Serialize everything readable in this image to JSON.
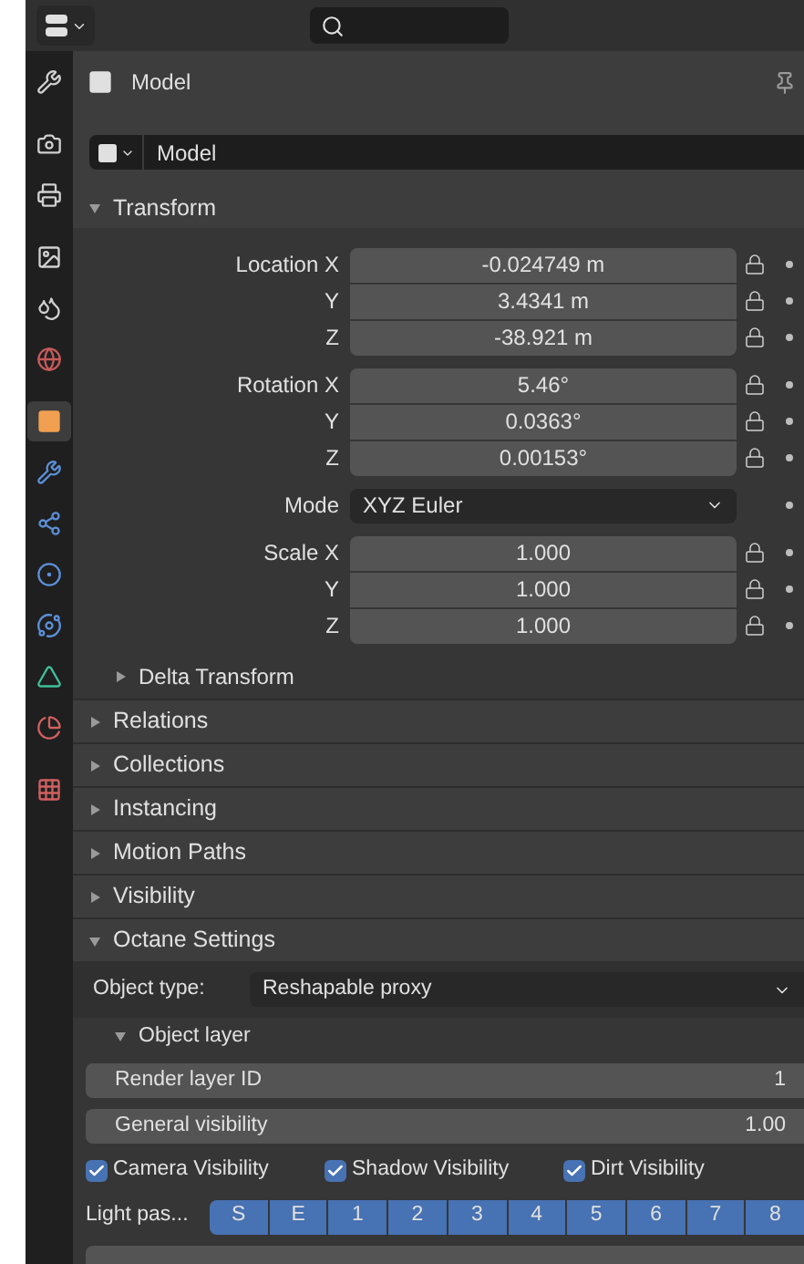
{
  "sidebar": {
    "tabs": [
      {
        "kind": "tool",
        "selected": false
      },
      {
        "kind": "render",
        "selected": false
      },
      {
        "kind": "output",
        "selected": false
      },
      {
        "kind": "view_layer",
        "selected": false
      },
      {
        "kind": "scene",
        "selected": false
      },
      {
        "kind": "world",
        "selected": false
      },
      {
        "kind": "object",
        "selected": true
      },
      {
        "kind": "modifier",
        "selected": false
      },
      {
        "kind": "particles",
        "selected": false
      },
      {
        "kind": "physics",
        "selected": false
      },
      {
        "kind": "constraints",
        "selected": false
      },
      {
        "kind": "data",
        "selected": false
      },
      {
        "kind": "material",
        "selected": false
      },
      {
        "kind": "texture",
        "selected": false
      }
    ]
  },
  "context": {
    "title": "Model"
  },
  "datablock": {
    "value": "Model"
  },
  "transform": {
    "title": "Transform",
    "expanded": true,
    "groups": [
      {
        "kind": "vector",
        "rows": [
          {
            "label": "Location X",
            "value": "-0.024749 m"
          },
          {
            "label": "Y",
            "value": "3.4341 m"
          },
          {
            "label": "Z",
            "value": "-38.921 m"
          }
        ]
      },
      {
        "kind": "vector",
        "rows": [
          {
            "label": "Rotation X",
            "value": "5.46°"
          },
          {
            "label": "Y",
            "value": "0.0363°"
          },
          {
            "label": "Z",
            "value": "0.00153°"
          }
        ]
      },
      {
        "kind": "enum",
        "label": "Mode",
        "value": "XYZ Euler"
      },
      {
        "kind": "vector",
        "rows": [
          {
            "label": "Scale X",
            "value": "1.000"
          },
          {
            "label": "Y",
            "value": "1.000"
          },
          {
            "label": "Z",
            "value": "1.000"
          }
        ]
      }
    ],
    "delta": {
      "title": "Delta Transform",
      "expanded": false
    }
  },
  "panels": [
    {
      "title": "Relations",
      "expanded": false
    },
    {
      "title": "Collections",
      "expanded": false
    },
    {
      "title": "Instancing",
      "expanded": false
    },
    {
      "title": "Motion Paths",
      "expanded": false
    },
    {
      "title": "Visibility",
      "expanded": false
    },
    {
      "title": "Octane Settings",
      "expanded": true
    }
  ],
  "octane": {
    "object_type": {
      "label": "Object type:",
      "value": "Reshapable proxy"
    },
    "object_layer": {
      "title": "Object layer",
      "expanded": true
    },
    "fields": [
      {
        "label": "Render layer ID",
        "value": "1"
      },
      {
        "label": "General visibility",
        "value": "1.00"
      }
    ],
    "checkboxes": [
      {
        "label": "Camera Visibility",
        "checked": true
      },
      {
        "label": "Shadow Visibility",
        "checked": true
      },
      {
        "label": "Dirt Visibility",
        "checked": true
      }
    ],
    "light_pass": {
      "label": "Light pas...",
      "buttons": [
        {
          "label": "S",
          "selected": true
        },
        {
          "label": "E",
          "selected": true
        },
        {
          "label": "1",
          "selected": true
        },
        {
          "label": "2",
          "selected": true
        },
        {
          "label": "3",
          "selected": true
        },
        {
          "label": "4",
          "selected": true
        },
        {
          "label": "5",
          "selected": true
        },
        {
          "label": "6",
          "selected": true
        },
        {
          "label": "7",
          "selected": true
        },
        {
          "label": "8",
          "selected": true
        }
      ]
    }
  }
}
